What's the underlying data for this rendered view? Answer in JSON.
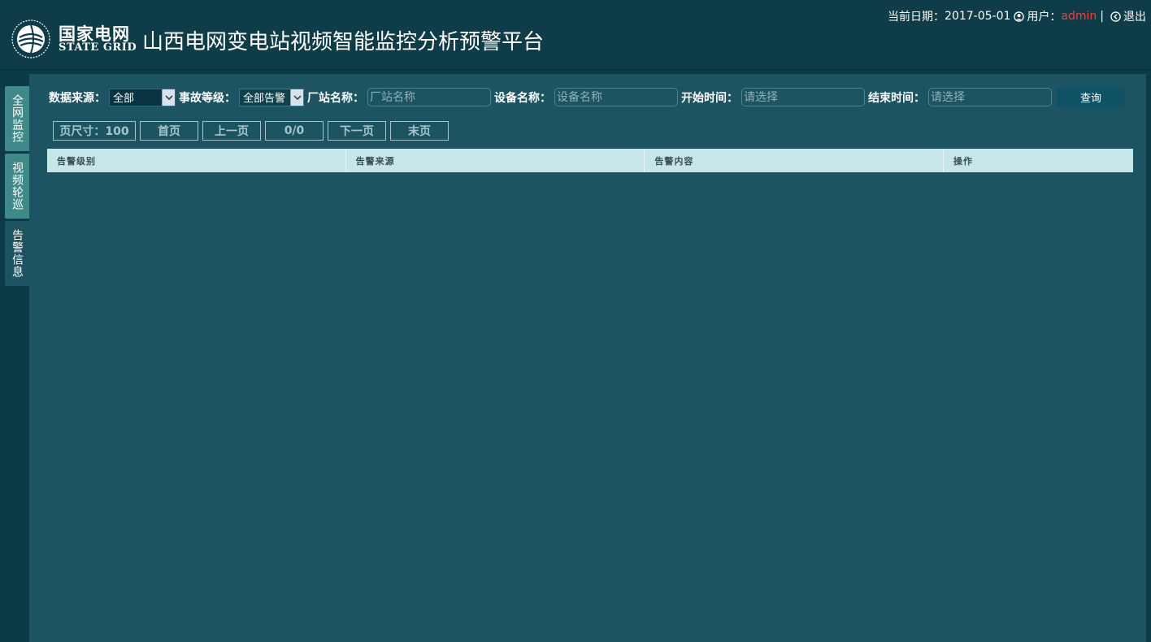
{
  "header": {
    "logo_cn": "国家电网",
    "logo_en": "STATE GRID",
    "title": "山西电网变电站视频智能监控分析预警平台",
    "date_label": "当前日期：",
    "date_value": "2017-05-01",
    "user_label": "用户：",
    "user_name": "admin",
    "separator": "|",
    "logout_label": "退出"
  },
  "sidebar": {
    "items": [
      {
        "label": "全网监控",
        "active": false
      },
      {
        "label": "视频轮巡",
        "active": false
      },
      {
        "label": "告警信息",
        "active": true
      }
    ]
  },
  "filters": {
    "source_label": "数据来源：",
    "source_value": "全部",
    "level_label": "事故等级：",
    "level_value": "全部告警",
    "station_label": "厂站名称：",
    "station_placeholder": "厂站名称",
    "device_label": "设备名称：",
    "device_placeholder": "设备名称",
    "start_label": "开始时间：",
    "start_placeholder": "请选择",
    "end_label": "结束时间：",
    "end_placeholder": "请选择",
    "query_button": "查询"
  },
  "pager": {
    "page_size": "页尺寸：100",
    "first": "首页",
    "prev": "上一页",
    "counter": "0/0",
    "next": "下一页",
    "last": "末页"
  },
  "table": {
    "columns": [
      "告警级别",
      "告警来源",
      "告警内容",
      "操作"
    ],
    "rows": []
  },
  "colors": {
    "background": "#0d3a47",
    "panel": "#1d5462",
    "tab": "#3f8a88",
    "table_header": "#c7e6e8",
    "user_accent": "#e8443b"
  }
}
